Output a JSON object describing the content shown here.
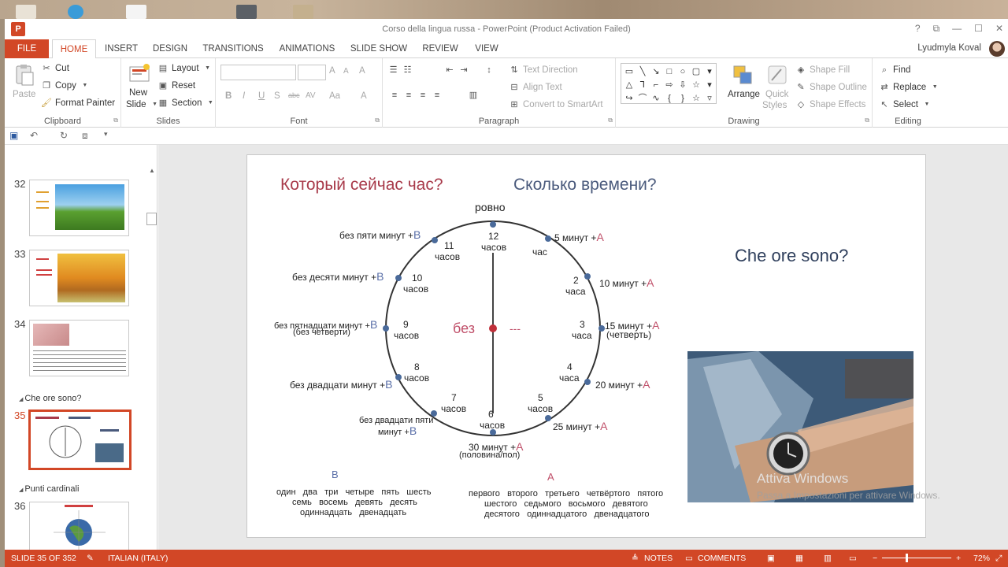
{
  "window": {
    "title": "Corso della lingua russa - PowerPoint (Product Activation Failed)",
    "app_icon": "P",
    "controls": [
      "?",
      "⧉",
      "—",
      "☐",
      "✕"
    ]
  },
  "tabs": [
    "FILE",
    "HOME",
    "INSERT",
    "DESIGN",
    "TRANSITIONS",
    "ANIMATIONS",
    "SLIDE SHOW",
    "REVIEW",
    "VIEW"
  ],
  "active_tab": "HOME",
  "user": "Lyudmyla Koval",
  "ribbon": {
    "clipboard": {
      "label": "Clipboard",
      "paste": "Paste",
      "cut": "Cut",
      "copy": "Copy",
      "format_painter": "Format Painter"
    },
    "slides": {
      "label": "Slides",
      "new_slide_1": "New",
      "new_slide_2": "Slide",
      "layout": "Layout",
      "reset": "Reset",
      "section": "Section"
    },
    "font": {
      "label": "Font",
      "bold": "B",
      "italic": "I",
      "underline": "U",
      "shadow": "S",
      "strike": "abc",
      "spacing": "AV",
      "case": "Aa",
      "color": "A",
      "grow": "A",
      "shrink": "A",
      "clear": "A"
    },
    "paragraph": {
      "label": "Paragraph",
      "text_direction": "Text Direction",
      "align_text": "Align Text",
      "convert_smartart": "Convert to SmartArt"
    },
    "drawing": {
      "label": "Drawing",
      "arrange": "Arrange",
      "quick_styles_1": "Quick",
      "quick_styles_2": "Styles",
      "shape_fill": "Shape Fill",
      "shape_outline": "Shape Outline",
      "shape_effects": "Shape Effects"
    },
    "editing": {
      "label": "Editing",
      "find": "Find",
      "replace": "Replace",
      "select": "Select"
    }
  },
  "thumbnails": [
    {
      "num": "32",
      "active": false
    },
    {
      "num": "33",
      "active": false
    },
    {
      "num": "34",
      "active": false
    },
    {
      "num": "35",
      "active": true
    },
    {
      "num": "36",
      "active": false
    }
  ],
  "sections": [
    "Che ore sono?",
    "Punti cardinali"
  ],
  "slide": {
    "title_left": "Который сейчас час?",
    "title_right": "Сколько времени?",
    "title_it": "Che ore sono?",
    "top_label": "ровно",
    "center_label": "без",
    "center_dash": "---",
    "hours": [
      {
        "num": "12",
        "word": "часов"
      },
      {
        "num": "",
        "word": "час"
      },
      {
        "num": "2",
        "word": "часа"
      },
      {
        "num": "3",
        "word": "часа"
      },
      {
        "num": "4",
        "word": "часа"
      },
      {
        "num": "5",
        "word": "часов"
      },
      {
        "num": "6",
        "word": "часов"
      },
      {
        "num": "7",
        "word": "часов"
      },
      {
        "num": "8",
        "word": "часов"
      },
      {
        "num": "9",
        "word": "часов"
      },
      {
        "num": "10",
        "word": "часов"
      },
      {
        "num": "11",
        "word": "часов"
      }
    ],
    "right_labels": [
      {
        "text": "5 минут +",
        "case": "A"
      },
      {
        "text": "10 минут +",
        "case": "A"
      },
      {
        "text": "15 минут +",
        "case": "A",
        "sub": "(четверть)"
      },
      {
        "text": "20 минут +",
        "case": "A"
      },
      {
        "text": "25 минут +",
        "case": "A"
      },
      {
        "text": "30 минут +",
        "case": "A",
        "sub": "(половина/пол)"
      }
    ],
    "left_labels": [
      {
        "text": "без пяти минут +",
        "case": "B"
      },
      {
        "text": "без десяти минут +",
        "case": "B"
      },
      {
        "text": "без пятнадцати минут +",
        "case": "B",
        "sub": "(без четверти)"
      },
      {
        "text": "без двадцати минут +",
        "case": "B"
      },
      {
        "text": "без двадцати пяти",
        "case": "B",
        "sub": "минут +"
      }
    ],
    "legend_b": {
      "title": "B",
      "line1": "один   два   три   четыре   пять   шесть",
      "line2": "семь   восемь   девять   десять",
      "line3": "одиннадцать   двенадцать"
    },
    "legend_a": {
      "title": "A",
      "line1": "первого   второго   третьего   четвёртого   пятого",
      "line2": "шестого   седьмого   восьмого   девятого",
      "line3": "десятого   одиннадцатого   двенадцатого"
    }
  },
  "watermark": {
    "line1": "Attiva Windows",
    "line2": "Passa a Impostazioni per attivare Windows."
  },
  "status": {
    "slide": "SLIDE 35 OF 352",
    "language": "ITALIAN (ITALY)",
    "notes": "NOTES",
    "comments": "COMMENTS",
    "zoom": "72%"
  },
  "colors": {
    "accent": "#d24726",
    "title_red": "#a83a4a",
    "title_blue": "#4a5a7c",
    "case_b": "#5a6fa8",
    "case_a": "#c0506a",
    "clock_dot": "#4a6a9a",
    "center_dot": "#c0303a"
  }
}
